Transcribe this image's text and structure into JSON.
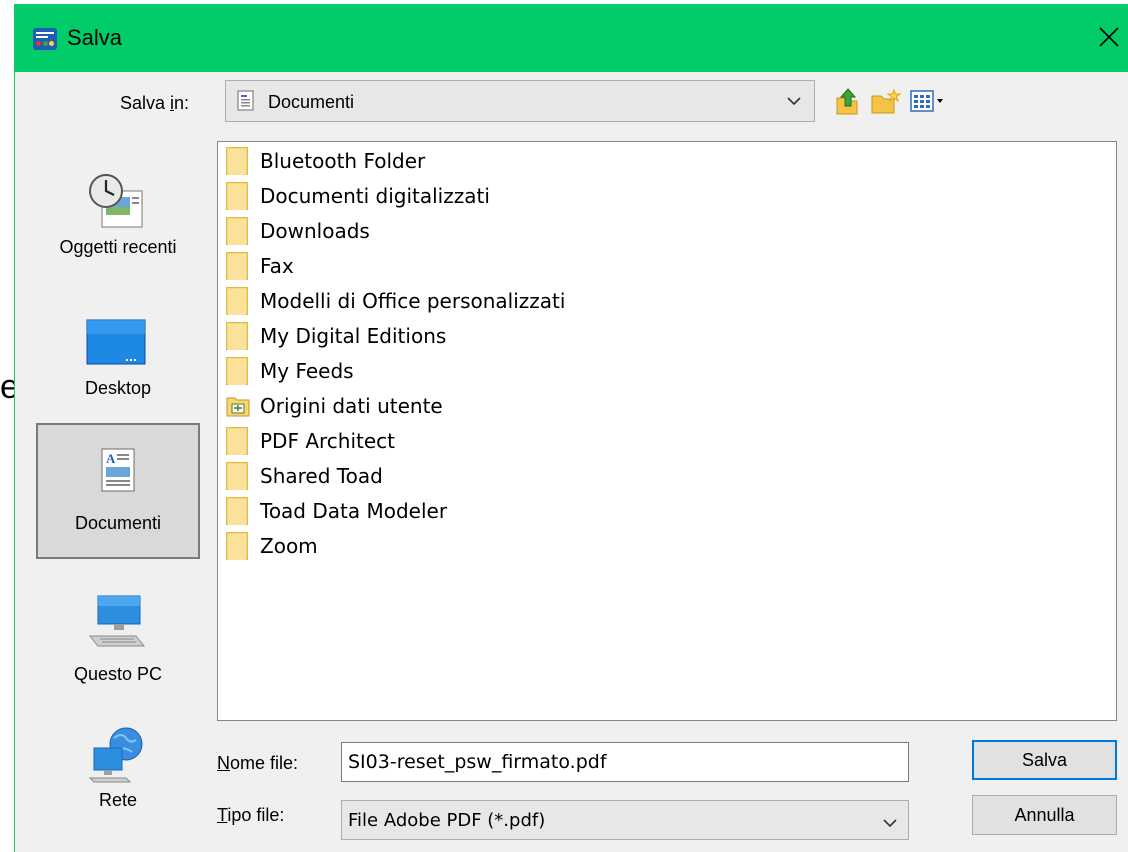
{
  "background_glyph": "e",
  "window": {
    "title": "Salva",
    "title_icon": "app-logo-icon",
    "close_icon": "close-icon",
    "titlebar_color": "#00cc6a"
  },
  "location": {
    "label": "Salva in:",
    "label_underline_char": "i",
    "current": "Documenti"
  },
  "toolbar": {
    "icons": [
      "up-folder-icon",
      "new-folder-icon",
      "view-menu-icon"
    ]
  },
  "places": [
    {
      "label": "Oggetti recenti",
      "icon": "recent-items-icon"
    },
    {
      "label": "Desktop",
      "icon": "desktop-icon"
    },
    {
      "label": "Documenti",
      "icon": "documents-icon",
      "selected": true
    },
    {
      "label": "Questo PC",
      "icon": "computer-icon"
    },
    {
      "label": "Rete",
      "icon": "network-icon"
    }
  ],
  "files": [
    {
      "name": "Bluetooth Folder",
      "icon": "folder-icon"
    },
    {
      "name": "Documenti digitalizzati",
      "icon": "folder-icon"
    },
    {
      "name": "Downloads",
      "icon": "folder-icon"
    },
    {
      "name": "Fax",
      "icon": "folder-icon"
    },
    {
      "name": "Modelli di Office personalizzati",
      "icon": "folder-icon"
    },
    {
      "name": "My Digital Editions",
      "icon": "folder-icon"
    },
    {
      "name": "My Feeds",
      "icon": "folder-icon"
    },
    {
      "name": "Origini dati utente",
      "icon": "data-source-folder-icon"
    },
    {
      "name": "PDF Architect",
      "icon": "folder-icon"
    },
    {
      "name": "Shared Toad",
      "icon": "folder-icon"
    },
    {
      "name": "Toad Data Modeler",
      "icon": "folder-icon"
    },
    {
      "name": "Zoom",
      "icon": "folder-icon"
    }
  ],
  "filename": {
    "label": "Nome file:",
    "value": "SI03-reset_psw_firmato.pdf"
  },
  "filetype": {
    "label": "Tipo file:",
    "value": "File Adobe PDF (*.pdf)"
  },
  "buttons": {
    "save": "Salva",
    "cancel": "Annulla"
  }
}
